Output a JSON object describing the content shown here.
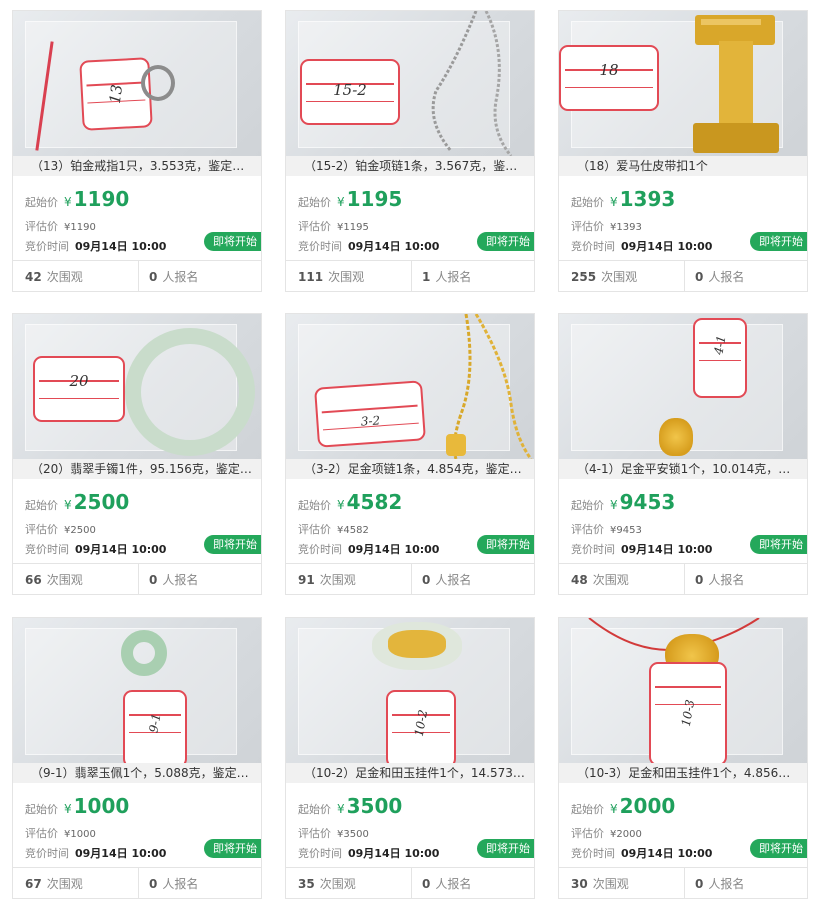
{
  "common": {
    "start_label": "起始价",
    "estimate_label": "评估价",
    "time_label": "竞价时间",
    "currency": "¥",
    "status_label": "即将开始",
    "views_suffix": "次围观",
    "signups_suffix": "人报名"
  },
  "colors": {
    "price_green": "#1fa05c",
    "badge_green": "#24a85b",
    "tag_red": "#e24a55"
  },
  "lots": [
    {
      "caption": "（13）铂金戒指1只，3.553克，鉴定…",
      "tag": "13",
      "price": "1190",
      "estimate": "¥1190",
      "time": "09月14日 10:00",
      "views": "42",
      "signups": "0"
    },
    {
      "caption": "（15-2）铂金项链1条，3.567克，鉴…",
      "tag": "15-2",
      "price": "1195",
      "estimate": "¥1195",
      "time": "09月14日 10:00",
      "views": "111",
      "signups": "1"
    },
    {
      "caption": "（18）爱马仕皮带扣1个",
      "tag": "18",
      "price": "1393",
      "estimate": "¥1393",
      "time": "09月14日 10:00",
      "views": "255",
      "signups": "0"
    },
    {
      "caption": "（20）翡翠手镯1件，95.156克，鉴定…",
      "tag": "20",
      "price": "2500",
      "estimate": "¥2500",
      "time": "09月14日 10:00",
      "views": "66",
      "signups": "0"
    },
    {
      "caption": "（3-2）足金项链1条，4.854克，鉴定…",
      "tag": "3-2",
      "price": "4582",
      "estimate": "¥4582",
      "time": "09月14日 10:00",
      "views": "91",
      "signups": "0"
    },
    {
      "caption": "（4-1）足金平安锁1个，10.014克，…",
      "tag": "4-1",
      "price": "9453",
      "estimate": "¥9453",
      "time": "09月14日 10:00",
      "views": "48",
      "signups": "0"
    },
    {
      "caption": "（9-1）翡翠玉佩1个，5.088克，鉴定…",
      "tag": "9-1",
      "price": "1000",
      "estimate": "¥1000",
      "time": "09月14日 10:00",
      "views": "67",
      "signups": "0"
    },
    {
      "caption": "（10-2）足金和田玉挂件1个，14.573…",
      "tag": "10-2",
      "price": "3500",
      "estimate": "¥3500",
      "time": "09月14日 10:00",
      "views": "35",
      "signups": "0"
    },
    {
      "caption": "（10-3）足金和田玉挂件1个，4.856…",
      "tag": "10-3",
      "price": "2000",
      "estimate": "¥2000",
      "time": "09月14日 10:00",
      "views": "30",
      "signups": "0"
    }
  ]
}
